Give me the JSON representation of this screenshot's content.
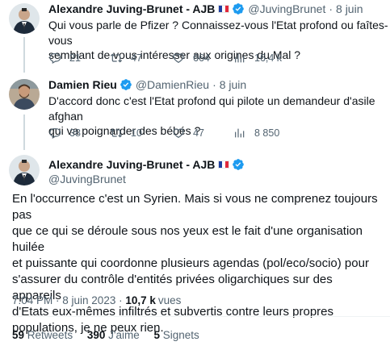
{
  "tweets": [
    {
      "name": "Alexandre Juving-Brunet - AJB",
      "handle": "@JuvingBrunet",
      "time": "8 juin",
      "text_lines": [
        "Qui vous parle de Pfizer ? Connaissez-vous l'Etat profond ou faîtes-vous",
        "semblant de vous intéresser aux origines du Mal ?"
      ],
      "replies": "21",
      "retweets": "47",
      "likes": "664",
      "views": "16,4 k"
    },
    {
      "name": "Damien Rieu",
      "handle": "@DamienRieu",
      "time": "8 juin",
      "text_lines": [
        "D'accord donc c'est l'Etat profond qui pilote un demandeur d'asile afghan",
        "qui va poignarder des bébés ?"
      ],
      "replies": "38",
      "retweets": "10",
      "likes": "47",
      "views": "8 850"
    }
  ],
  "main_tweet": {
    "name": "Alexandre Juving-Brunet - AJB",
    "handle": "@JuvingBrunet",
    "text_lines": [
      "En l'occurrence c'est un Syrien. Mais si vous ne comprenez toujours pas",
      "que ce qui se déroule sous nos yeux est le fait d'une organisation huilée",
      "et puissante qui coordonne plusieurs agendas (pol/eco/socio) pour",
      "s'assurer du contrôle d'entités privées oligarchiques sur des appareils",
      "d'Etats eux-mêmes infiltrés et subvertis contre leurs propres",
      "populations, je ne peux rien."
    ],
    "timestamp": "7:04 PM · 8 juin 2023 · ",
    "views_count": "10,7 k",
    "views_label": "vues",
    "retweets_count": "59",
    "retweets_label": "Retweets",
    "likes_count": "390",
    "likes_label": "J'aime",
    "bookmarks_count": "5",
    "bookmarks_label": "Signets"
  },
  "colors": {
    "verified": "#1d9bf0",
    "text": "#0f1419",
    "secondary": "#536471",
    "thread_line": "#cfd9de"
  },
  "icons": [
    "reply-icon",
    "retweet-icon",
    "like-icon",
    "views-icon",
    "verified-icon",
    "france-flag-icon"
  ]
}
